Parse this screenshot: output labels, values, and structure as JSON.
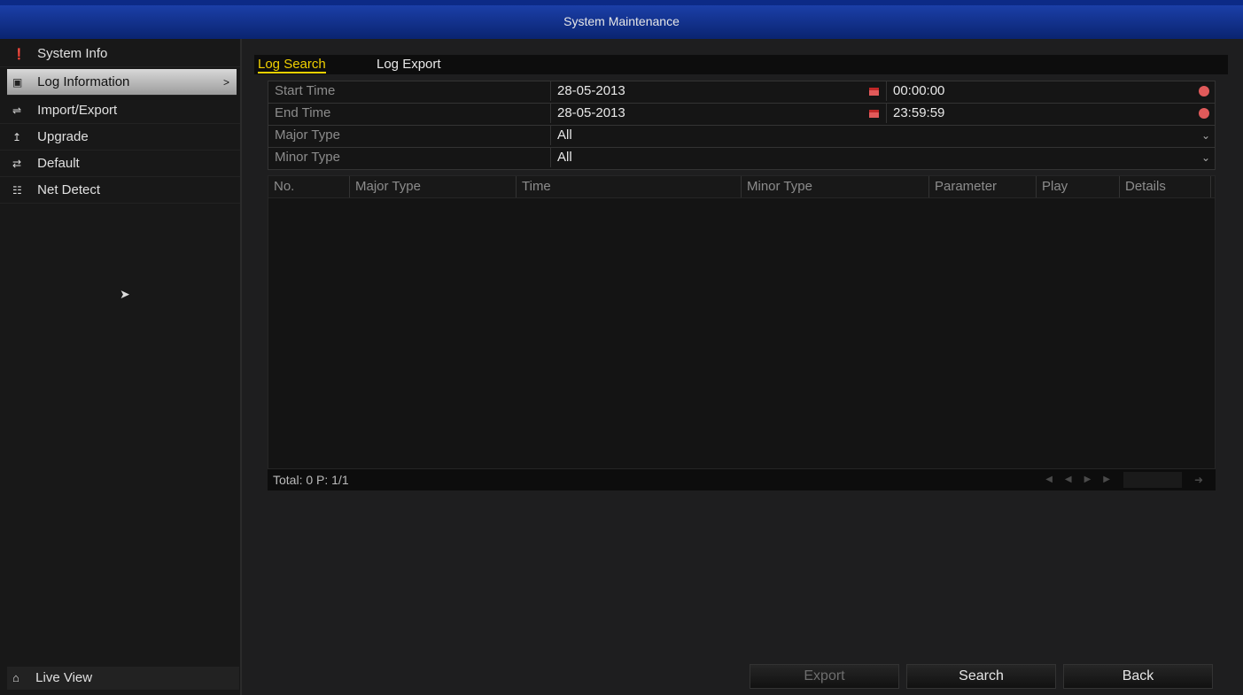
{
  "window": {
    "title": "System Maintenance"
  },
  "sidebar": {
    "items": [
      {
        "label": "System Info",
        "icon": "info-icon"
      },
      {
        "label": "Log Information",
        "icon": "log-search-icon",
        "active": true
      },
      {
        "label": "Import/Export",
        "icon": "import-export-icon"
      },
      {
        "label": "Upgrade",
        "icon": "upgrade-icon"
      },
      {
        "label": "Default",
        "icon": "default-icon"
      },
      {
        "label": "Net Detect",
        "icon": "net-detect-icon"
      }
    ],
    "live_view": {
      "label": "Live View",
      "icon": "home-icon"
    }
  },
  "tabs": [
    {
      "label": "Log Search",
      "active": true
    },
    {
      "label": "Log Export",
      "active": false
    }
  ],
  "form": {
    "start_time": {
      "label": "Start Time",
      "date": "28-05-2013",
      "time": "00:00:00"
    },
    "end_time": {
      "label": "End Time",
      "date": "28-05-2013",
      "time": "23:59:59"
    },
    "major_type": {
      "label": "Major Type",
      "value": "All"
    },
    "minor_type": {
      "label": "Minor Type",
      "value": "All"
    }
  },
  "table": {
    "columns": [
      "No.",
      "Major Type",
      "Time",
      "Minor Type",
      "Parameter",
      "Play",
      "Details"
    ],
    "rows": [],
    "footer": {
      "total": "Total: 0  P: 1/1"
    }
  },
  "buttons": {
    "export": "Export",
    "search": "Search",
    "back": "Back"
  },
  "colors": {
    "title_bar": "#0a2470",
    "active_tab": "#f0d000",
    "accent_red": "#e05a5a"
  }
}
